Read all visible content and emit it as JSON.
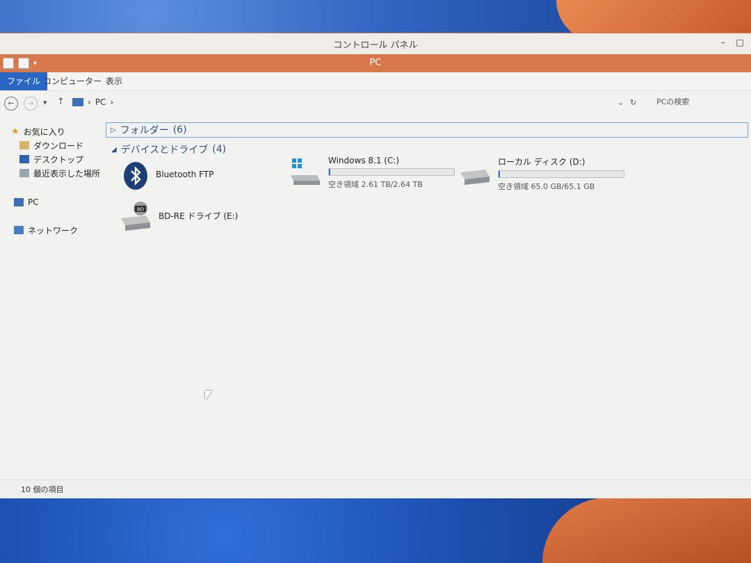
{
  "window": {
    "outer_title": "コントロール パネル",
    "title": "PC",
    "minimize": "–",
    "maximize": "□"
  },
  "ribbon": {
    "tabs": [
      {
        "label": "ファイル"
      },
      {
        "label": "コンピューター"
      },
      {
        "label": "表示"
      }
    ]
  },
  "address": {
    "back": "←",
    "forward": "→",
    "up": "↑",
    "path": [
      "PC"
    ],
    "separator": "›",
    "dropdown": "⌄",
    "refresh": "↻",
    "search_placeholder": "PCの検索"
  },
  "sidebar": {
    "items": [
      {
        "label": "お気に入り",
        "icon": "star-icon"
      },
      {
        "label": "ダウンロード",
        "icon": "download-folder-icon"
      },
      {
        "label": "デスクトップ",
        "icon": "desktop-icon"
      },
      {
        "label": "最近表示した場所",
        "icon": "recent-places-icon"
      },
      {
        "label": "PC",
        "icon": "computer-icon"
      },
      {
        "label": "ネットワーク",
        "icon": "network-icon"
      }
    ]
  },
  "content": {
    "groups": [
      {
        "label": "フォルダー",
        "count": "(6)"
      },
      {
        "label": "デバイスとドライブ",
        "count": "(4)"
      }
    ],
    "devices": [
      {
        "name": "Bluetooth FTP",
        "icon": "bluetooth-icon"
      },
      {
        "name": "Windows 8.1 (C:)",
        "icon": "windows-drive-icon",
        "space": "空き領域 2.61 TB/2.64 TB",
        "used_fraction": 0.011
      },
      {
        "name": "ローカル ディスク (D:)",
        "icon": "hard-drive-icon",
        "space": "空き領域 65.0 GB/65.1 GB",
        "used_fraction": 0.002
      },
      {
        "name": "BD-RE ドライブ (E:)",
        "icon": "bd-drive-icon"
      }
    ]
  },
  "status": {
    "count": "10 個の項目"
  },
  "colors": {
    "accent_tab": "#2a67c4",
    "titlebar": "#d9784c",
    "bar_fill": "#2a78d6"
  }
}
